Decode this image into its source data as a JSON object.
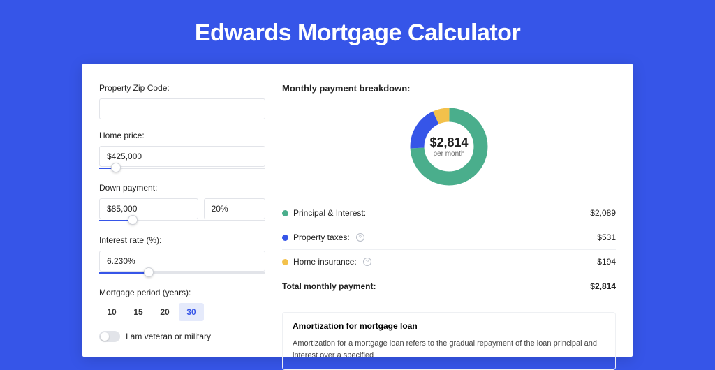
{
  "page": {
    "title": "Edwards Mortgage Calculator"
  },
  "form": {
    "zip_label": "Property Zip Code:",
    "zip_value": "",
    "home_price_label": "Home price:",
    "home_price_value": "$425,000",
    "home_price_slider_pct": 10,
    "down_payment_label": "Down payment:",
    "down_payment_value": "$85,000",
    "down_payment_pct": "20%",
    "down_payment_slider_pct": 20,
    "interest_label": "Interest rate (%):",
    "interest_value": "6.230%",
    "interest_slider_pct": 30,
    "period_label": "Mortgage period (years):",
    "period_options": [
      "10",
      "15",
      "20",
      "30"
    ],
    "period_active": "30",
    "veteran_label": "I am veteran or military"
  },
  "breakdown": {
    "title": "Monthly payment breakdown:",
    "donut_amount": "$2,814",
    "donut_sub": "per month",
    "items": [
      {
        "label": "Principal & Interest:",
        "value": "$2,089",
        "color": "green"
      },
      {
        "label": "Property taxes:",
        "value": "$531",
        "color": "blue",
        "info": true
      },
      {
        "label": "Home insurance:",
        "value": "$194",
        "color": "yellow",
        "info": true
      }
    ],
    "total_label": "Total monthly payment:",
    "total_value": "$2,814"
  },
  "amortization": {
    "title": "Amortization for mortgage loan",
    "text": "Amortization for a mortgage loan refers to the gradual repayment of the loan principal and interest over a specified"
  },
  "chart_data": {
    "type": "pie",
    "title": "Monthly payment breakdown",
    "center_label": "$2,814 per month",
    "series": [
      {
        "name": "Principal & Interest",
        "value": 2089,
        "color": "#4AAE8C"
      },
      {
        "name": "Property taxes",
        "value": 531,
        "color": "#3655E8"
      },
      {
        "name": "Home insurance",
        "value": 194,
        "color": "#F3C14B"
      }
    ],
    "total": 2814
  }
}
